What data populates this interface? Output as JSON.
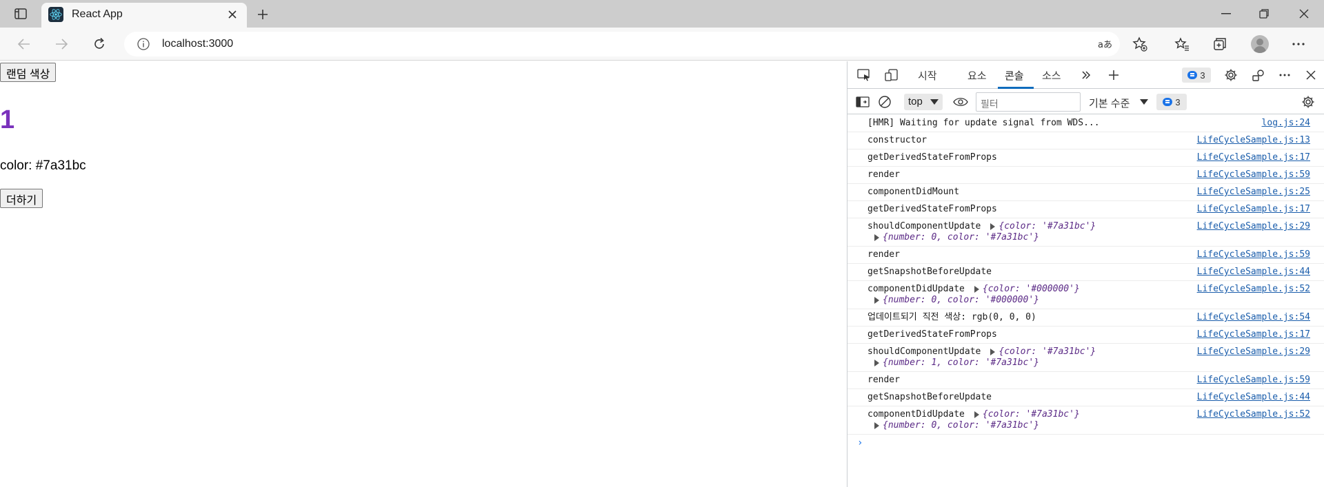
{
  "browser": {
    "tab_title": "React App",
    "url": "localhost:3000"
  },
  "page": {
    "random_color_button": "랜덤 색상",
    "number": "1",
    "number_color": "#7a31bc",
    "color_line": "color: #7a31bc",
    "add_button": "더하기"
  },
  "devtools": {
    "tabs": [
      "시작",
      "요소",
      "콘솔",
      "소스"
    ],
    "active_tab": "콘솔",
    "issue_count": "3",
    "context": "top",
    "filter_placeholder": "필터",
    "levels": "기본 수준",
    "filter_issue_count": "3",
    "logs": [
      {
        "text": "[HMR] Waiting for update signal from WDS...",
        "src": "log.js:24"
      },
      {
        "text": "constructor",
        "src": "LifeCycleSample.js:13"
      },
      {
        "text": "getDerivedStateFromProps",
        "src": "LifeCycleSample.js:17"
      },
      {
        "text": "render",
        "src": "LifeCycleSample.js:59"
      },
      {
        "text": "componentDidMount",
        "src": "LifeCycleSample.js:25"
      },
      {
        "text": "getDerivedStateFromProps",
        "src": "LifeCycleSample.js:17"
      },
      {
        "text": "shouldComponentUpdate",
        "src": "LifeCycleSample.js:29",
        "obj1": "{color: '#7a31bc'}",
        "obj2": "{number: 0, color: '#7a31bc'}"
      },
      {
        "text": "render",
        "src": "LifeCycleSample.js:59"
      },
      {
        "text": "getSnapshotBeforeUpdate",
        "src": "LifeCycleSample.js:44"
      },
      {
        "text": "componentDidUpdate",
        "src": "LifeCycleSample.js:52",
        "obj1": "{color: '#000000'}",
        "obj2": "{number: 0, color: '#000000'}"
      },
      {
        "text": "업데이트되기 직전 색상:  rgb(0, 0, 0)",
        "src": "LifeCycleSample.js:54"
      },
      {
        "text": "getDerivedStateFromProps",
        "src": "LifeCycleSample.js:17"
      },
      {
        "text": "shouldComponentUpdate",
        "src": "LifeCycleSample.js:29",
        "obj1": "{color: '#7a31bc'}",
        "obj2": "{number: 1, color: '#7a31bc'}"
      },
      {
        "text": "render",
        "src": "LifeCycleSample.js:59"
      },
      {
        "text": "getSnapshotBeforeUpdate",
        "src": "LifeCycleSample.js:44"
      },
      {
        "text": "componentDidUpdate",
        "src": "LifeCycleSample.js:52",
        "obj1": "{color: '#7a31bc'}",
        "obj2": "{number: 0, color: '#7a31bc'}"
      }
    ],
    "prompt_symbol": "›"
  }
}
